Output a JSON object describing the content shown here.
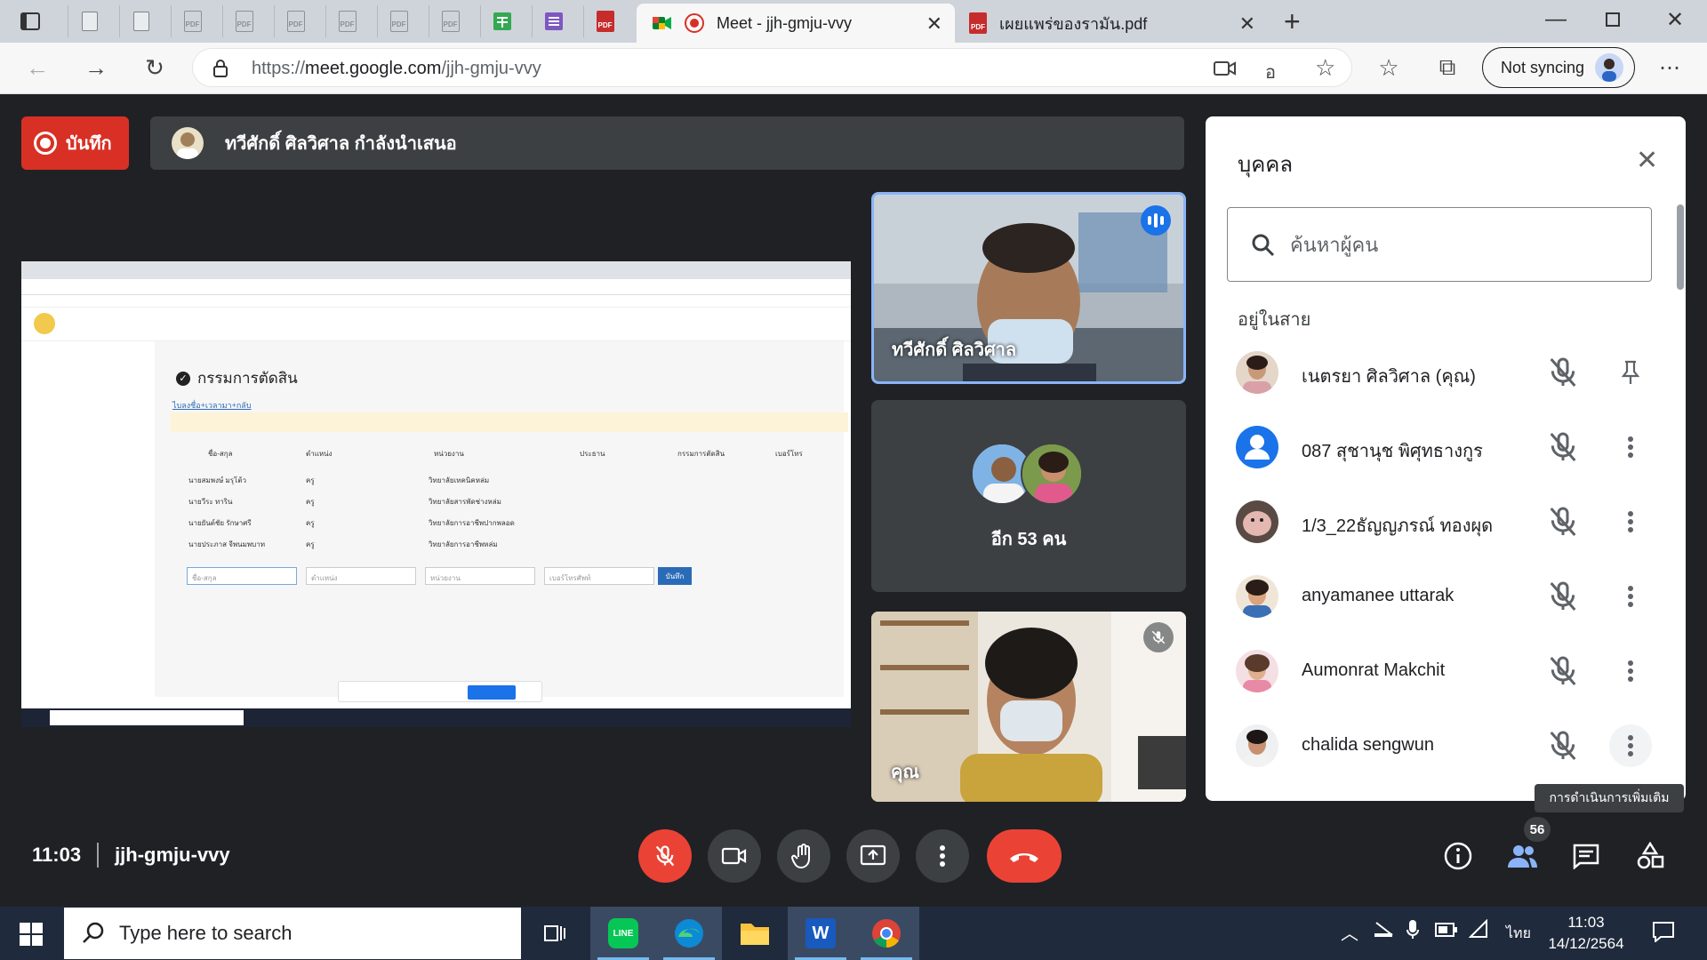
{
  "browser": {
    "active_tab_title": "Meet - jjh-gmju-vvy",
    "second_tab_title": "เผยแพร่ของรามัน.pdf",
    "url_prefix": "https://",
    "url_host": "meet.google.com",
    "url_path": "/jjh-gmju-vvy",
    "profile_label": "Not syncing"
  },
  "meet": {
    "record_label": "บันทึก",
    "presenting_text": "ทวีศักดิ์ ศิลวิศาล กำลังนำเสนอ",
    "tiles": [
      {
        "name": "ทวีศักดิ์ ศิลวิศาล"
      },
      {
        "name": "อีก 53 คน"
      },
      {
        "name": "คุณ"
      }
    ],
    "clock": "11:03",
    "meeting_code": "jjh-gmju-vvy",
    "participant_count": "56",
    "tooltip": "การดำเนินการเพิ่มเติม",
    "colors": {
      "accent": "#8ab4f8",
      "danger": "#ea4335",
      "record": "#d93025",
      "surface": "#3c4043"
    }
  },
  "people_panel": {
    "title": "บุคคล",
    "search_placeholder": "ค้นหาผู้คน",
    "section_label": "อยู่ในสาย",
    "participants": [
      {
        "name": "เนตรยา ศิลวิศาล (คุณ)",
        "action_icon": "pin-icon"
      },
      {
        "name": "087 สุชานุช พิศุทธางกูร",
        "action_icon": "more-vert-icon"
      },
      {
        "name": "1/3_22ธัญญภรณ์ ทองผุด",
        "action_icon": "more-vert-icon"
      },
      {
        "name": "anyamanee uttarak",
        "action_icon": "more-vert-icon"
      },
      {
        "name": "Aumonrat Makchit",
        "action_icon": "more-vert-icon"
      },
      {
        "name": "chalida sengwun",
        "action_icon": "more-vert-icon"
      }
    ]
  },
  "shared_screen": {
    "page_heading": "กรรมการตัดสิน",
    "back_link": "ไบลงชื่อ+เวลามา+กลับ",
    "columns": [
      "ชื่อ-สกุล",
      "ตำแหน่ง",
      "หน่วยงาน",
      "ประธาน",
      "กรรมการตัดสิน",
      "เบอร์โทร"
    ],
    "rows": [
      {
        "name": "นายสมพงษ์ มรุโต้ว",
        "position": "ครู",
        "org": "วิทยาลัยเทคนิคหล่ม"
      },
      {
        "name": "นายวีระ ทาริน",
        "position": "ครู",
        "org": "วิทยาลัยสารพัดช่างหล่ม"
      },
      {
        "name": "นายยันต์ชัย รักษาศรี",
        "position": "ครู",
        "org": "วิทยาลัยการอาชีพปากพลอด"
      },
      {
        "name": "นายประภาส จีพนมพบาท",
        "position": "ครู",
        "org": "วิทยาลัยการอาชีพหล่ม"
      }
    ],
    "input_placeholders": [
      "ชื่อ-สกุล",
      "ตำแหน่ง",
      "หน่วยงาน",
      "เบอร์โทรศัพท์"
    ],
    "save_label": "บันทึก"
  },
  "taskbar": {
    "search_placeholder": "Type here to search",
    "lang": "ไทย",
    "time": "11:03",
    "date": "14/12/2564"
  }
}
